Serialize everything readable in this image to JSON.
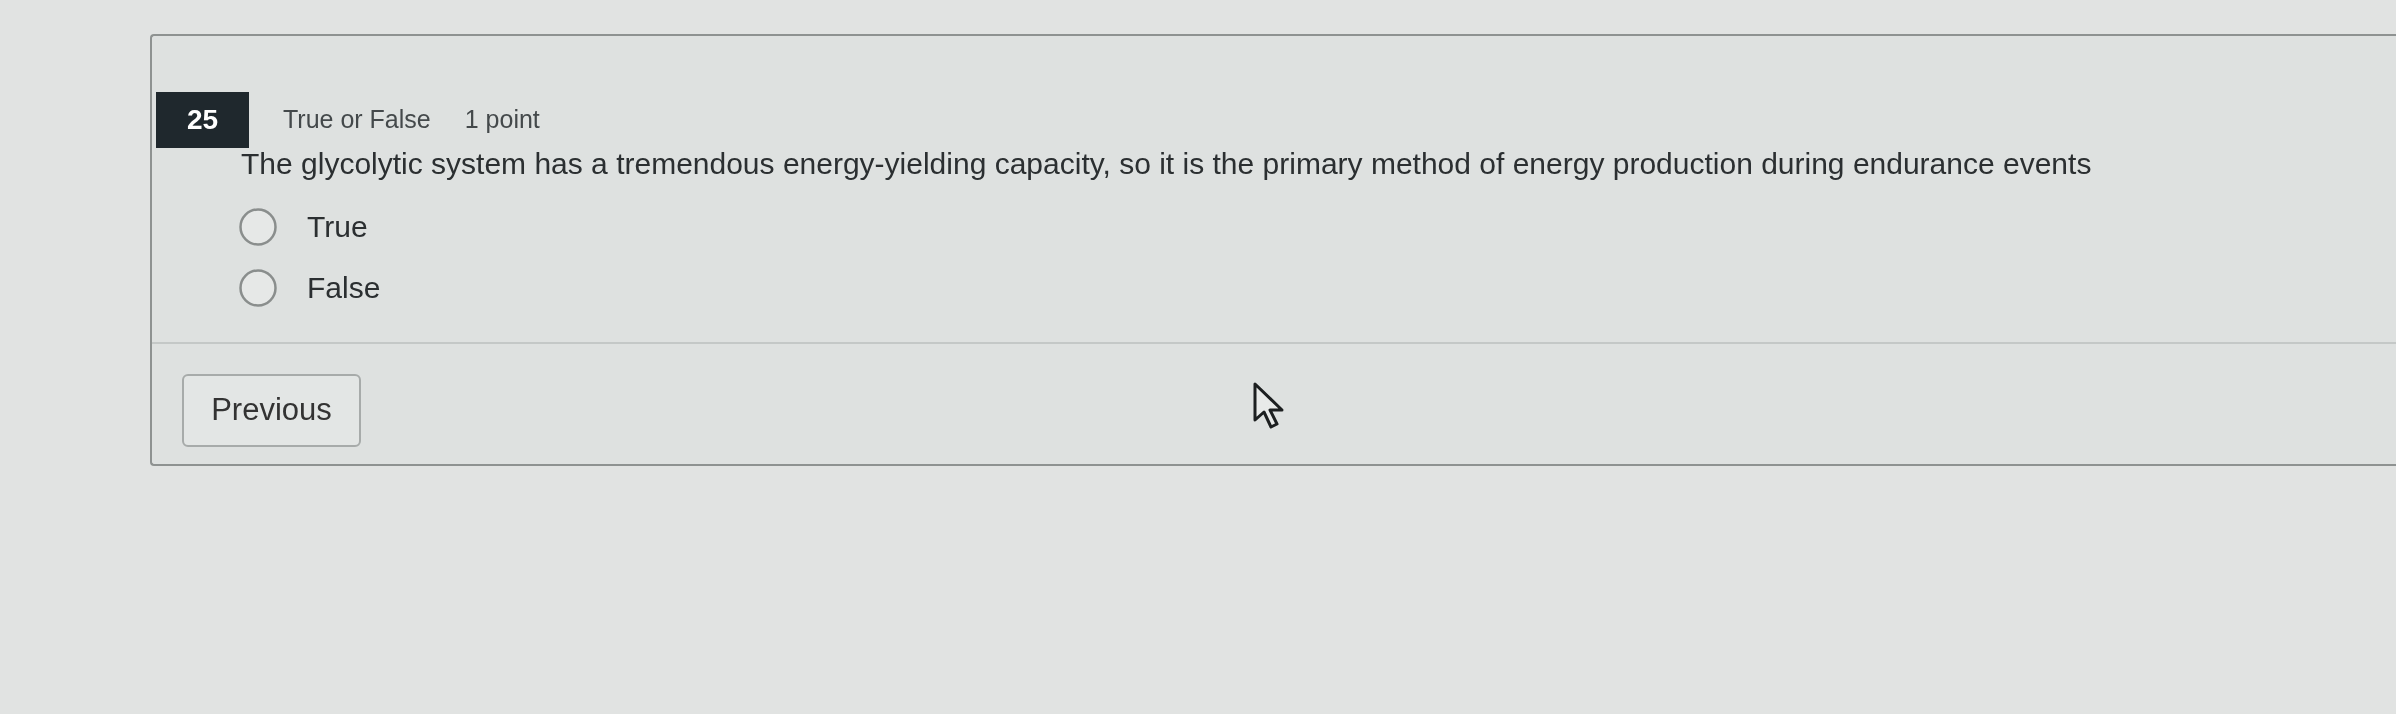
{
  "question": {
    "number": "25",
    "type": "True or False",
    "points": "1 point",
    "text": "The glycolytic system has a tremendous energy-yielding capacity, so it is the primary method of energy production during endurance events"
  },
  "options": [
    {
      "label": "True",
      "selected": false
    },
    {
      "label": "False",
      "selected": false
    }
  ],
  "buttons": [
    {
      "label": "Previous"
    }
  ]
}
